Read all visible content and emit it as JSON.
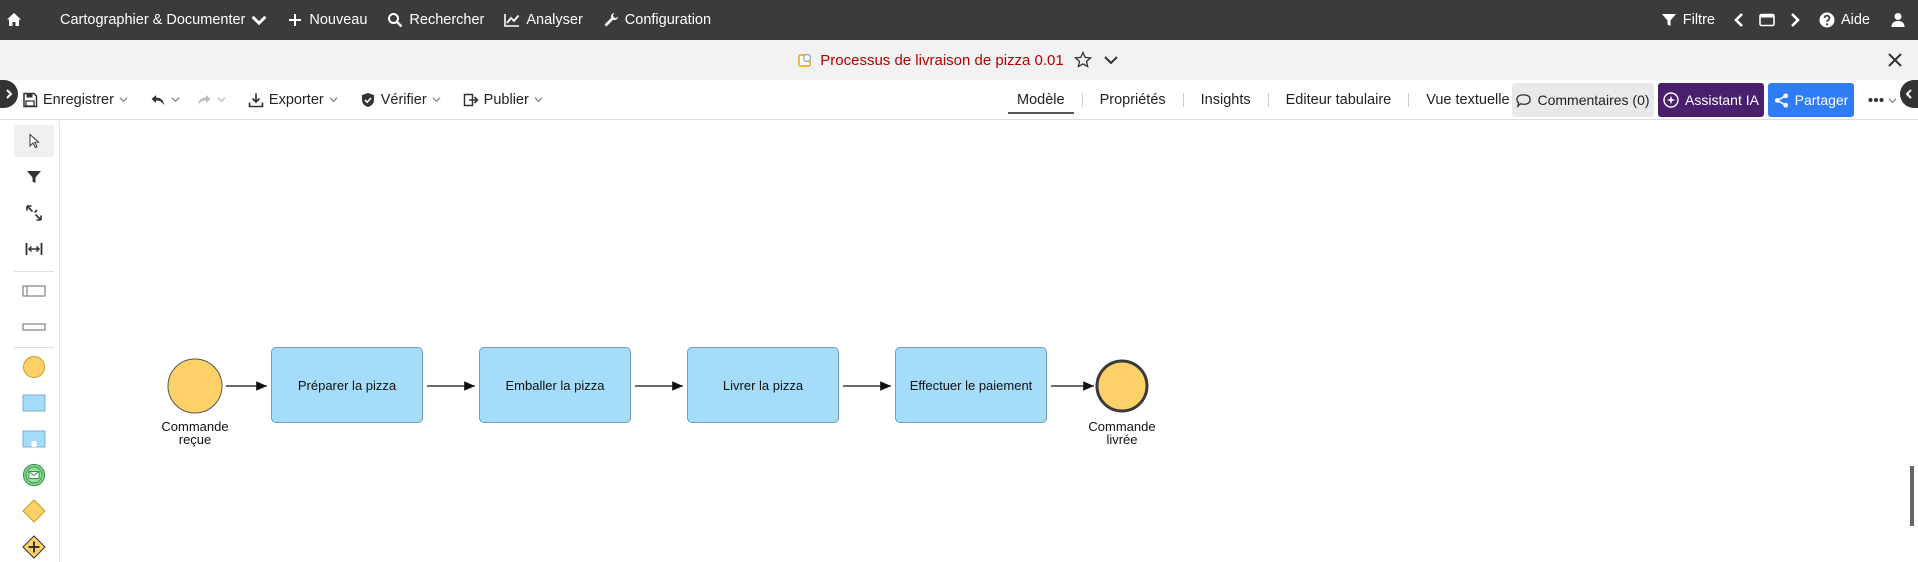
{
  "topbar": {
    "home_label": "",
    "menu_label": "Cartographier & Documenter",
    "new_label": "Nouveau",
    "search_label": "Rechercher",
    "analyze_label": "Analyser",
    "config_label": "Configuration",
    "filter_label": "Filtre",
    "help_label": "Aide"
  },
  "titlebar": {
    "title": "Processus de livraison de pizza 0.01"
  },
  "toolbar": {
    "save_label": "Enregistrer",
    "export_label": "Exporter",
    "verify_label": "Vérifier",
    "publish_label": "Publier",
    "tabs": [
      {
        "label": "Modèle",
        "active": true
      },
      {
        "label": "Propriétés",
        "active": false
      },
      {
        "label": "Insights",
        "active": false
      },
      {
        "label": "Editeur tabulaire",
        "active": false
      },
      {
        "label": "Vue textuelle",
        "active": false
      }
    ],
    "comments_label": "Commentaires (0)",
    "ai_label": "Assistant IA",
    "share_label": "Partager"
  },
  "diagram": {
    "start_event": "Commande\nreçue",
    "start_event_lines": [
      "Commande",
      "reçue"
    ],
    "tasks": [
      {
        "label": "Préparer la pizza"
      },
      {
        "label": "Emballer la pizza"
      },
      {
        "label": "Livrer la pizza"
      },
      {
        "label": "Effectuer le paiement"
      }
    ],
    "end_event_lines": [
      "Commande",
      "livrée"
    ]
  },
  "colors": {
    "topbar_bg": "#3b3b3b",
    "title_text": "#b30000",
    "task_fill": "#a5dcf9",
    "event_fill": "#fdd167",
    "ai_button": "#4a1f6e",
    "share_button": "#2f7df6"
  }
}
